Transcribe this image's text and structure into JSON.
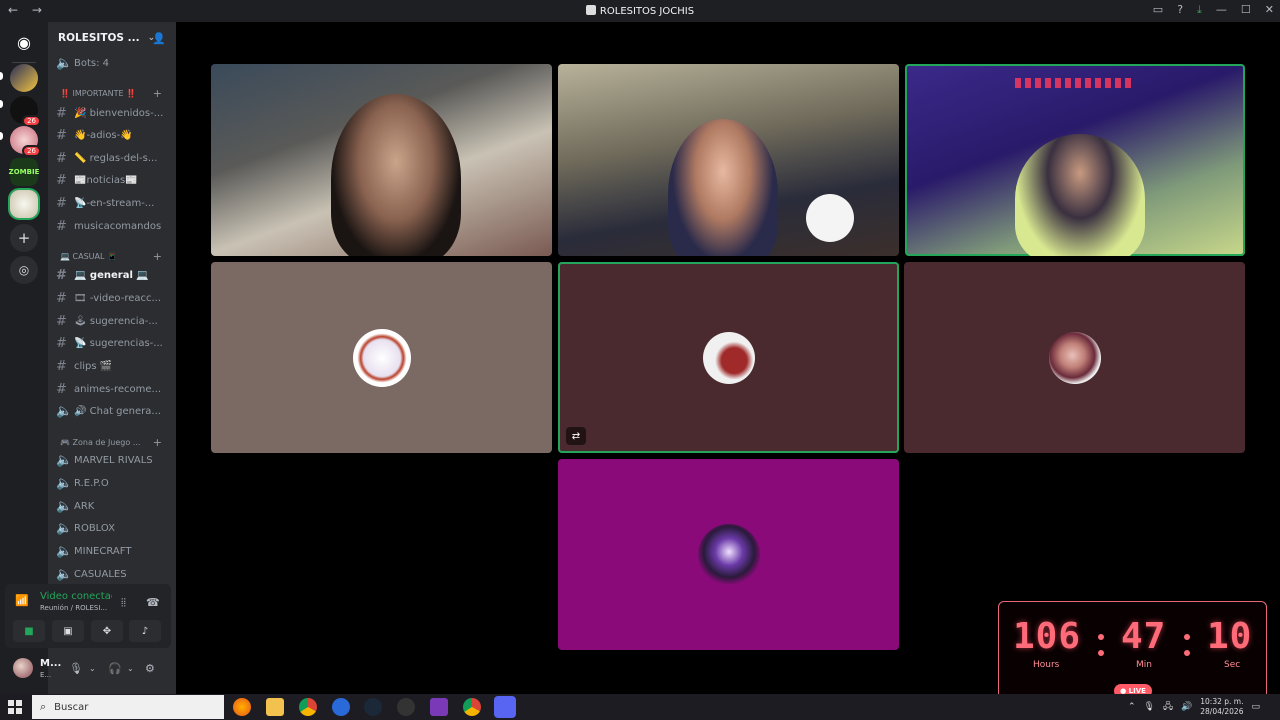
{
  "window": {
    "title": "ROLESITOS JOCHIS",
    "back": "←",
    "forward": "→"
  },
  "server": {
    "name": "ROLESITOS ...",
    "bots_channel": "Bots: 4"
  },
  "guilds": [
    {
      "badge": ""
    },
    {
      "badge": "26"
    },
    {
      "badge": "26"
    },
    {
      "badge": ""
    },
    {
      "badge": ""
    }
  ],
  "categories": {
    "importante": "‼️ IMPORTANTE ‼️",
    "casual": "💻 CASUAL 📱",
    "juegos": "🎮 Zona de Juego ..."
  },
  "channels_importante": [
    "🎉 bienvenidos-...",
    "👋-adios-👋",
    "📏 reglas-del-s...",
    "📰noticias📰",
    "📡-en-stream-...",
    "musicacomandos"
  ],
  "channels_casual": [
    "💻 general 💻",
    "🎞 -video-reacc...",
    "🕹 sugerencia-...",
    "📡 sugerencias-...",
    "clips 🎬",
    "animes-recome...",
    "🔊 Chat genera..."
  ],
  "channels_juegos": [
    "MARVEL RIVALS",
    "R.E.P.O",
    "ARK",
    "ROBLOX",
    "MINECRAFT",
    "CASUALES"
  ],
  "voice": {
    "status": "Video conectad",
    "location": "Reunión / ROLESI..."
  },
  "user": {
    "name": "M...",
    "status": "E..."
  },
  "timer": {
    "hours": "106",
    "minutes": "47",
    "seconds": "10",
    "hours_label": "Hours",
    "minutes_label": "Min",
    "seconds_label": "Sec",
    "live": "● LIVE"
  },
  "taskbar": {
    "search_placeholder": "Buscar",
    "time": "10:32 p. m.",
    "date": "28/04/2026"
  },
  "colors": {
    "discord_bg": "#2b2d31",
    "speaking_border": "#23a55a",
    "tile_brown": "#7b6a63",
    "tile_maroon": "#4a2a2e",
    "tile_purple": "#8a0a7a",
    "timer_red": "#ff6b78"
  }
}
